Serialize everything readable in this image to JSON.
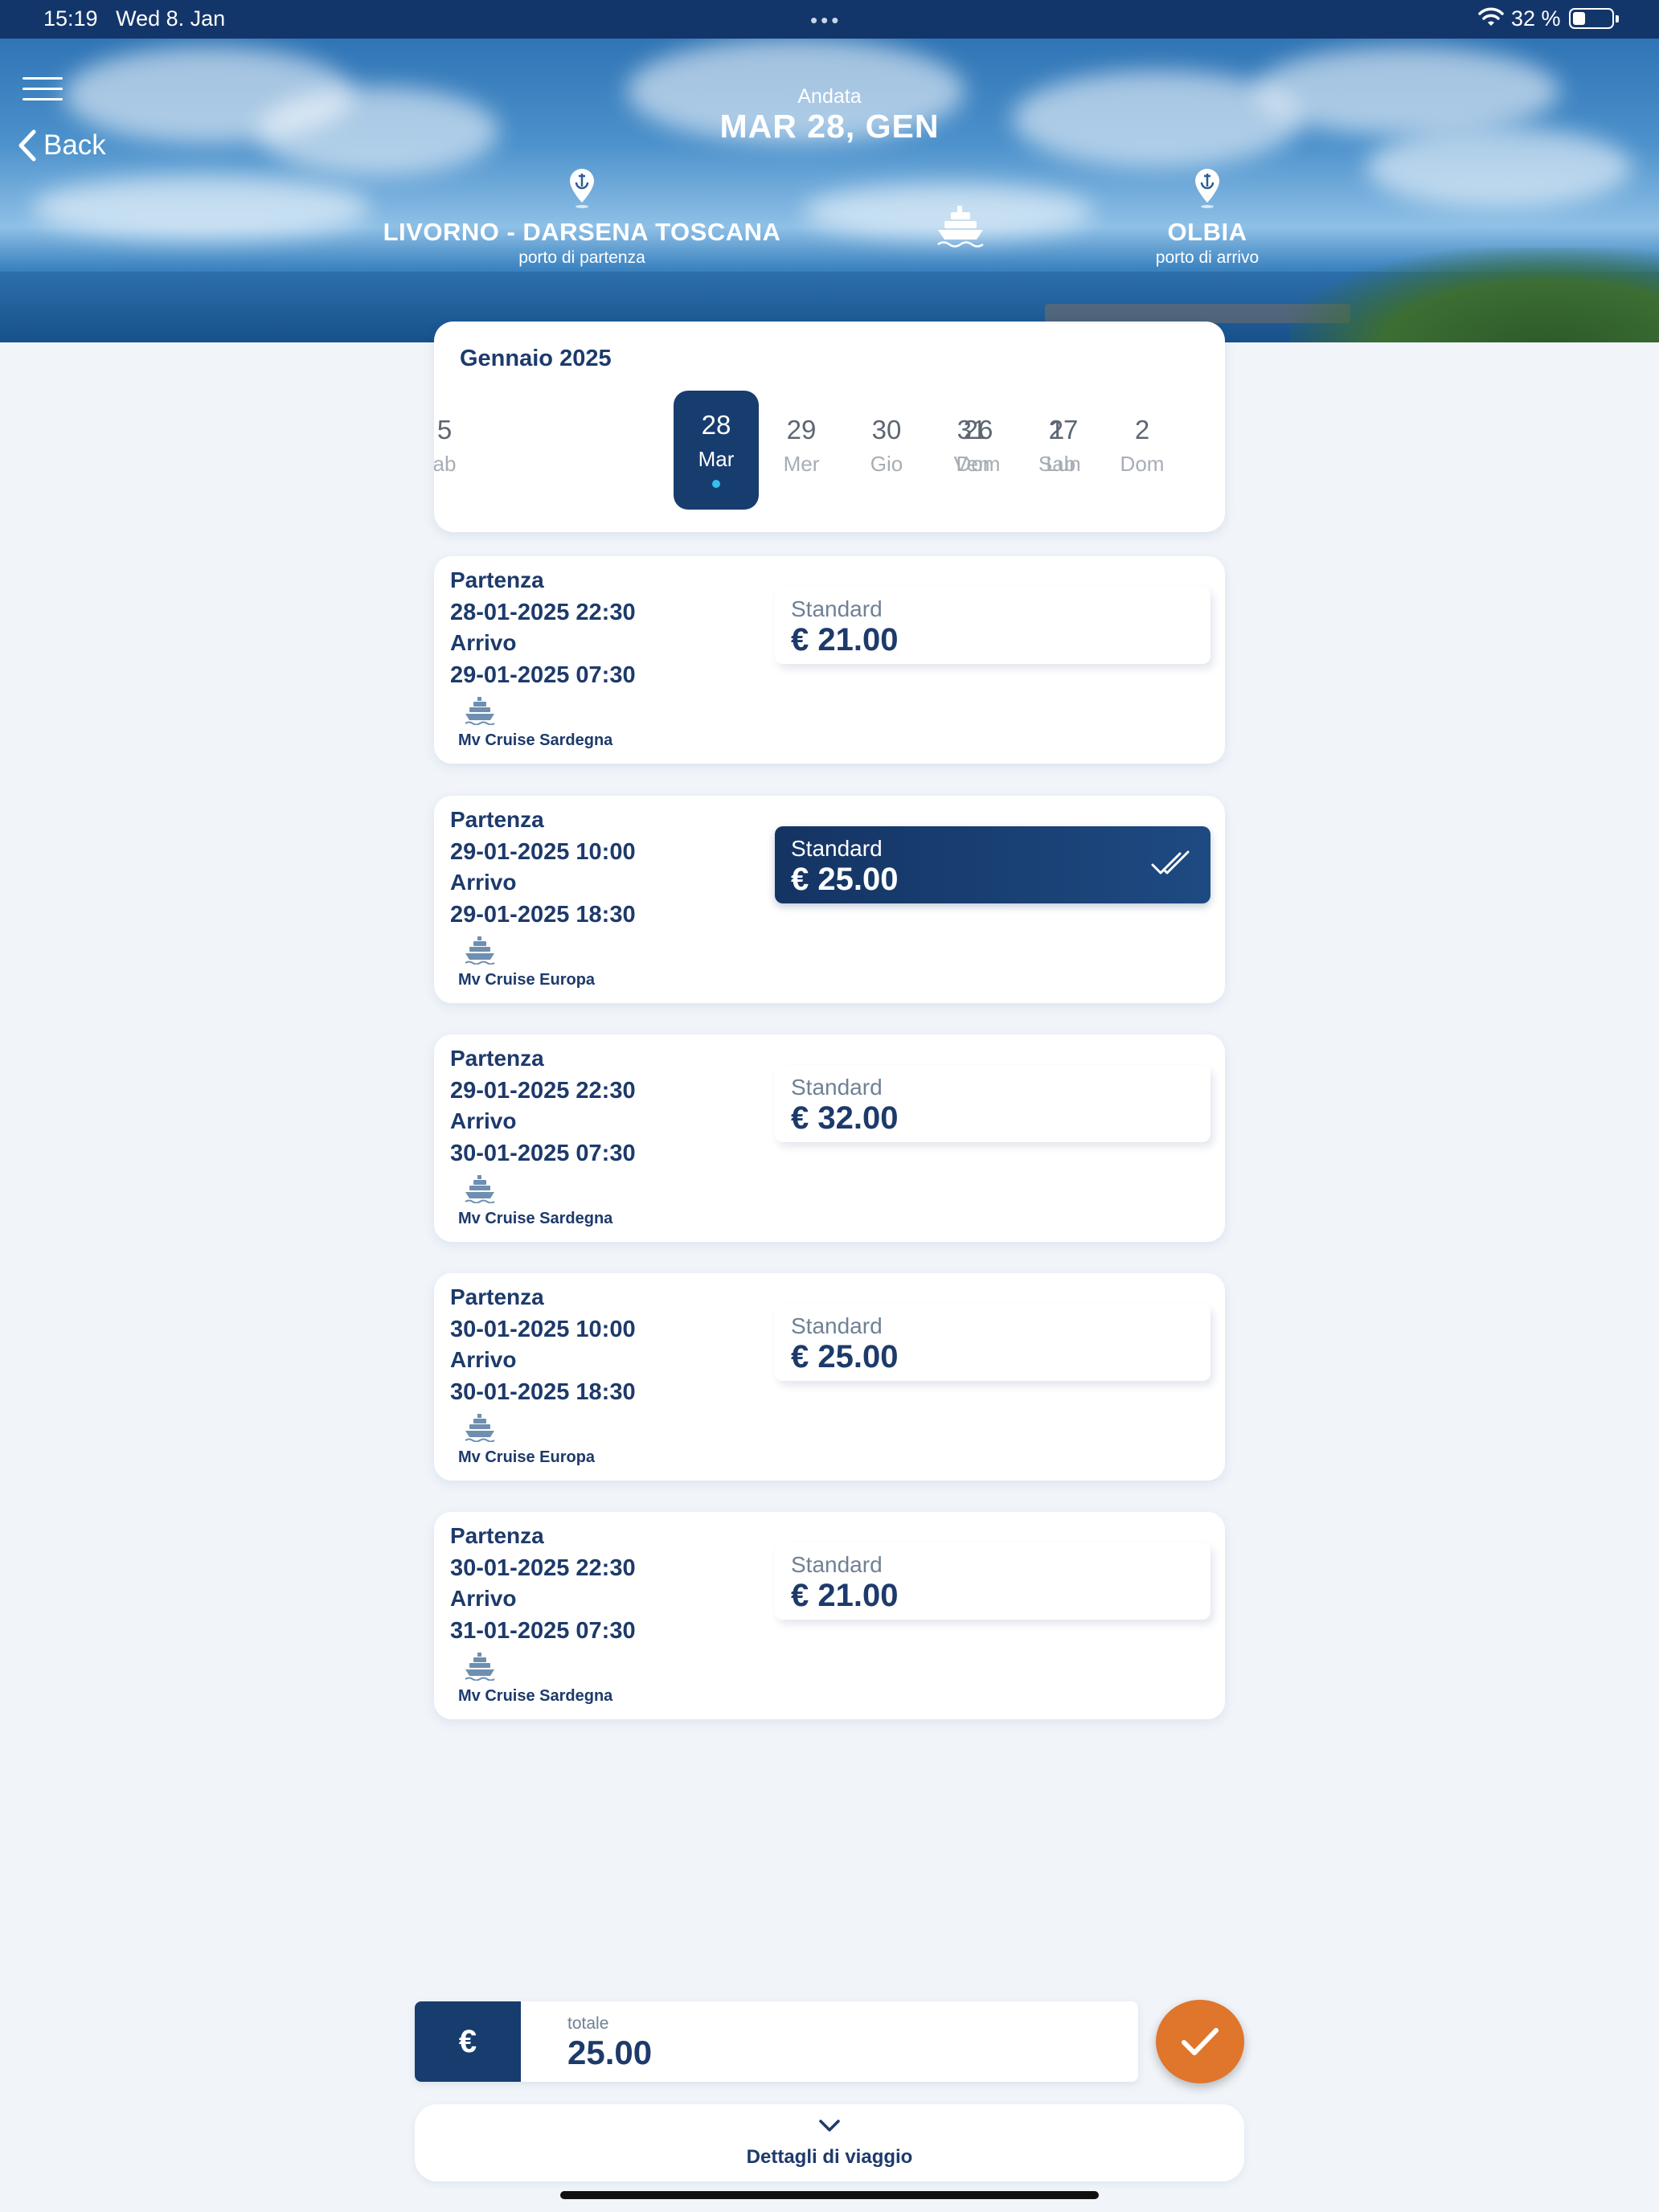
{
  "status_bar": {
    "time": "15:19",
    "date": "Wed 8. Jan",
    "battery": "32 %",
    "battery_level": 0.32
  },
  "header": {
    "back_label": "Back",
    "leg_label": "Andata",
    "date_title": "MAR 28, GEN",
    "departure_port": {
      "name": "LIVORNO - DARSENA TOSCANA",
      "caption": "porto di partenza"
    },
    "arrival_port": {
      "name": "OLBIA",
      "caption": "porto di arrivo"
    }
  },
  "calendar": {
    "month": "Gennaio 2025",
    "days": [
      {
        "num": "5",
        "wd": "ab"
      },
      {
        "num": "26",
        "wd": "Dom"
      },
      {
        "num": "27",
        "wd": "Lun"
      },
      {
        "num": "28",
        "wd": "Mar",
        "selected": true
      },
      {
        "num": "29",
        "wd": "Mer"
      },
      {
        "num": "30",
        "wd": "Gio"
      },
      {
        "num": "31",
        "wd": "Ven"
      },
      {
        "num": "1",
        "wd": "Sab"
      },
      {
        "num": "2",
        "wd": "Dom"
      }
    ]
  },
  "trips": [
    {
      "dep_label": "Partenza",
      "dep": "28-01-2025 22:30",
      "arr_label": "Arrivo",
      "arr": "29-01-2025 07:30",
      "vessel": "Mv Cruise Sardegna",
      "fare_class": "Standard",
      "price": "€ 21.00",
      "selected": false
    },
    {
      "dep_label": "Partenza",
      "dep": "29-01-2025 10:00",
      "arr_label": "Arrivo",
      "arr": "29-01-2025 18:30",
      "vessel": "Mv Cruise Europa",
      "fare_class": "Standard",
      "price": "€ 25.00",
      "selected": true
    },
    {
      "dep_label": "Partenza",
      "dep": "29-01-2025 22:30",
      "arr_label": "Arrivo",
      "arr": "30-01-2025 07:30",
      "vessel": "Mv Cruise Sardegna",
      "fare_class": "Standard",
      "price": "€ 32.00",
      "selected": false
    },
    {
      "dep_label": "Partenza",
      "dep": "30-01-2025 10:00",
      "arr_label": "Arrivo",
      "arr": "30-01-2025 18:30",
      "vessel": "Mv Cruise Europa",
      "fare_class": "Standard",
      "price": "€ 25.00",
      "selected": false
    },
    {
      "dep_label": "Partenza",
      "dep": "30-01-2025 22:30",
      "arr_label": "Arrivo",
      "arr": "31-01-2025 07:30",
      "vessel": "Mv Cruise Sardegna",
      "fare_class": "Standard",
      "price": "€ 21.00",
      "selected": false
    }
  ],
  "footer": {
    "currency_symbol": "€",
    "total_label": "totale",
    "total_value": "25.00",
    "details_label": "Dettagli di viaggio"
  },
  "colors": {
    "primary": "#173d6e",
    "accent": "#e0752c",
    "selected_dot": "#35c0ee",
    "background": "#f1f5fa"
  }
}
